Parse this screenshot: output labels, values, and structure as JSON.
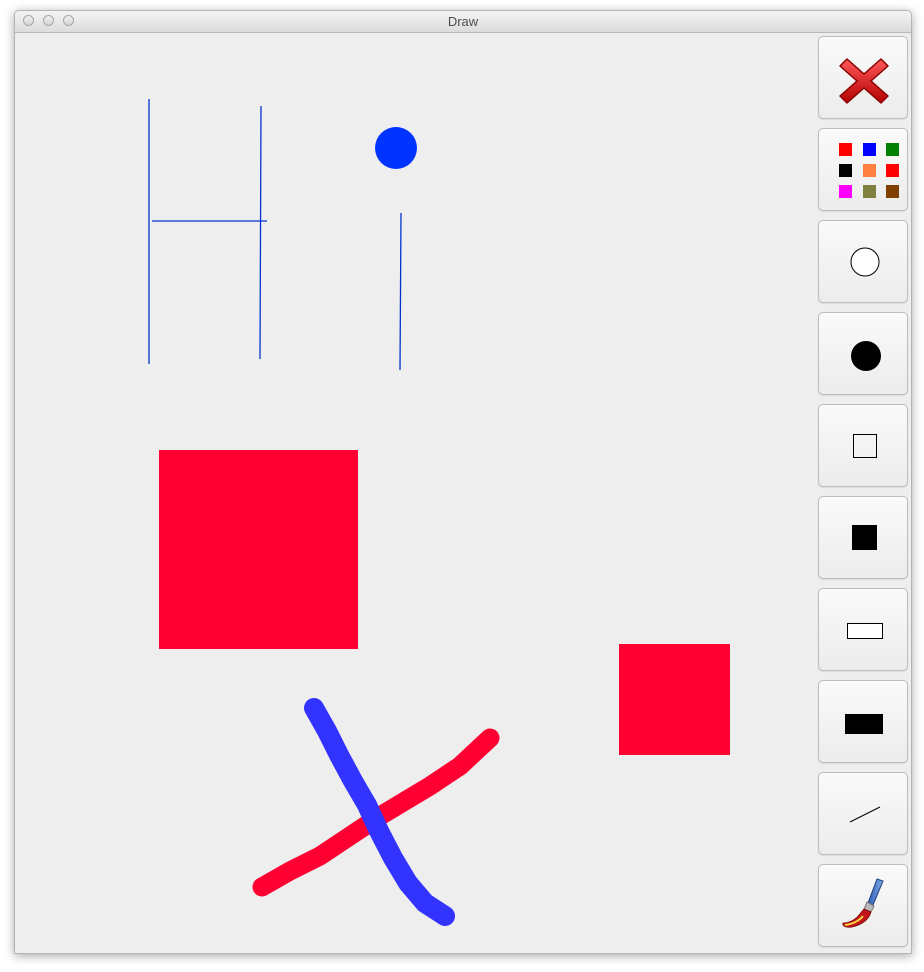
{
  "window": {
    "title": "Draw"
  },
  "colors": {
    "stroke_blue": "#0033cc",
    "dot_blue": "#0033ff",
    "shape_red": "#ff0033",
    "brush_red": "#ff0033",
    "brush_blue": "#3333ff"
  },
  "toolbar": {
    "buttons": [
      {
        "name": "clear",
        "icon": "close-icon"
      },
      {
        "name": "color-picker",
        "icon": "palette-icon"
      },
      {
        "name": "circle-outline",
        "icon": "circle-outline-icon"
      },
      {
        "name": "circle-filled",
        "icon": "circle-filled-icon"
      },
      {
        "name": "square-outline",
        "icon": "square-outline-icon"
      },
      {
        "name": "square-filled",
        "icon": "square-filled-icon"
      },
      {
        "name": "rectangle-outline",
        "icon": "rectangle-outline-icon"
      },
      {
        "name": "rectangle-filled",
        "icon": "rectangle-filled-icon"
      },
      {
        "name": "line",
        "icon": "line-icon"
      },
      {
        "name": "brush",
        "icon": "paintbrush-icon"
      }
    ],
    "palette": [
      "#ff0000",
      "#0000ff",
      "#008000",
      "#000000",
      "#ff8040",
      "#ff0000",
      "#ff00ff",
      "#808040",
      "#804000"
    ]
  }
}
